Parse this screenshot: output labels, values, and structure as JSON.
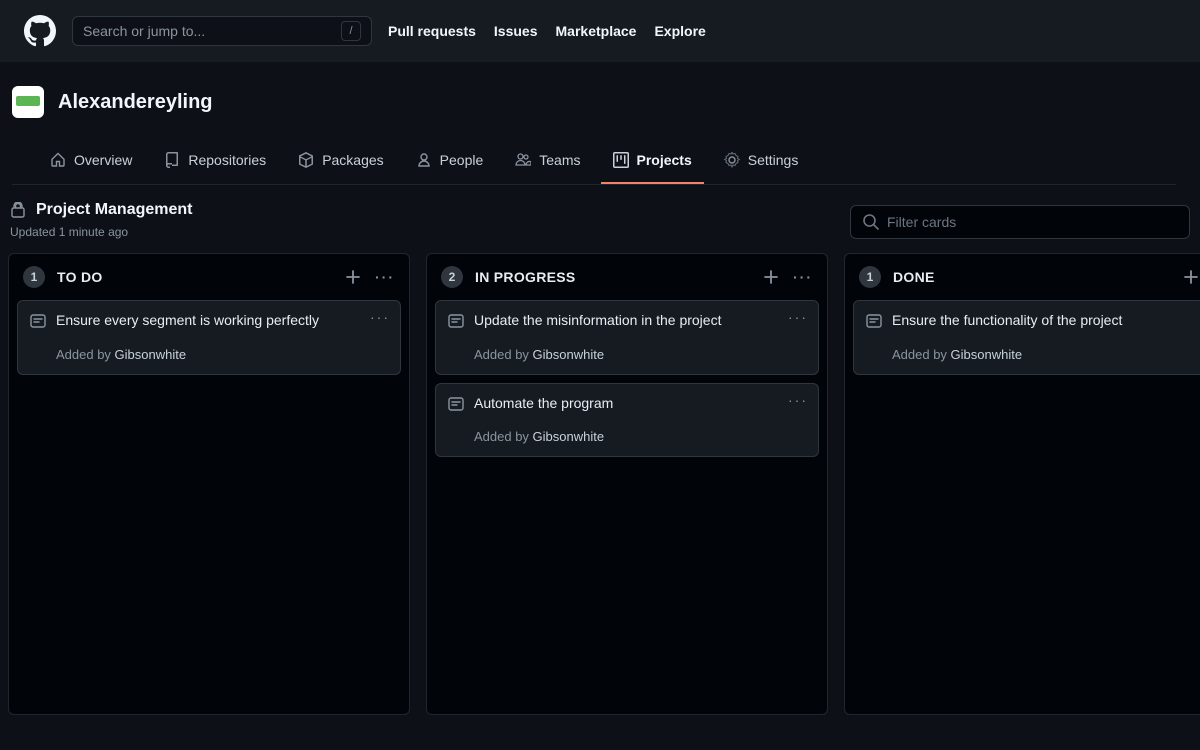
{
  "header": {
    "search_placeholder": "Search or jump to...",
    "search_key": "/",
    "nav": {
      "pull_requests": "Pull requests",
      "issues": "Issues",
      "marketplace": "Marketplace",
      "explore": "Explore"
    }
  },
  "org": {
    "name": "Alexandereyling"
  },
  "tabs": {
    "overview": "Overview",
    "repositories": "Repositories",
    "packages": "Packages",
    "people": "People",
    "teams": "Teams",
    "projects": "Projects",
    "settings": "Settings",
    "active": "projects"
  },
  "project": {
    "title": "Project Management",
    "updated": "Updated 1 minute ago",
    "filter_placeholder": "Filter cards"
  },
  "columns": [
    {
      "count": "1",
      "title": "TO DO",
      "cards": [
        {
          "title": "Ensure every segment is working perfectly",
          "added_by_prefix": "Added by ",
          "author": "Gibsonwhite"
        }
      ]
    },
    {
      "count": "2",
      "title": "IN PROGRESS",
      "cards": [
        {
          "title": "Update the misinformation in the project",
          "added_by_prefix": "Added by ",
          "author": "Gibsonwhite"
        },
        {
          "title": "Automate the program",
          "added_by_prefix": "Added by ",
          "author": "Gibsonwhite"
        }
      ]
    },
    {
      "count": "1",
      "title": "DONE",
      "cards": [
        {
          "title": "Ensure the functionality of the project",
          "added_by_prefix": "Added by ",
          "author": "Gibsonwhite"
        }
      ]
    }
  ]
}
